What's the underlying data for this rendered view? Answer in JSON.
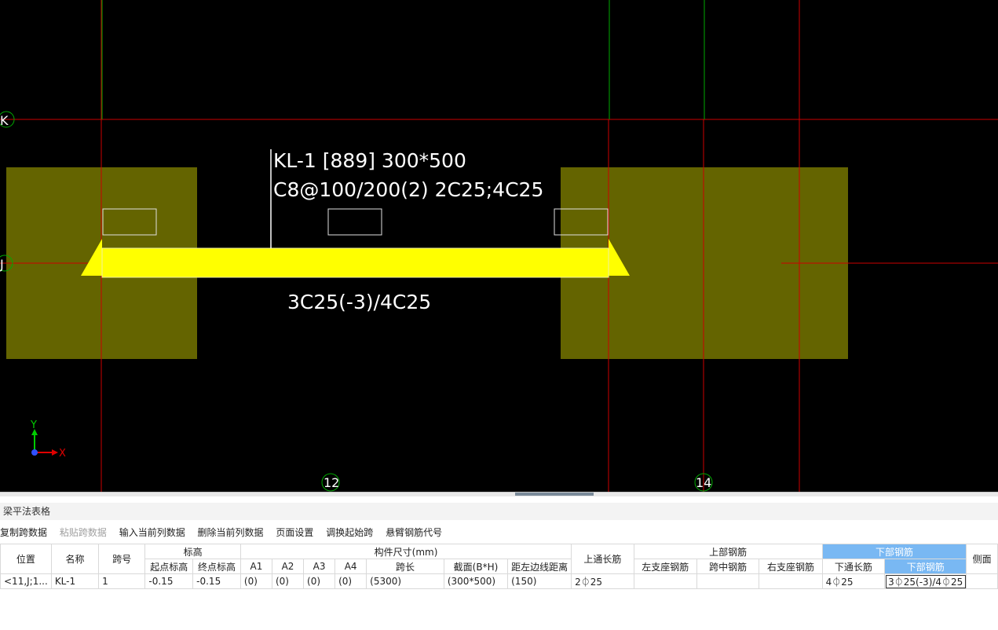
{
  "cad": {
    "axes": {
      "k": "K",
      "j": "J",
      "n12": "12",
      "n14": "14"
    },
    "beam_label_line1": "KL-1 [889] 300*500",
    "beam_label_line2": "C8@100/200(2) 2C25;4C25",
    "beam_bottom_label": "3C25(-3)/4C25",
    "ucs_x": "X",
    "ucs_y": "Y",
    "colors": {
      "background": "#000000",
      "beam": "#ffff00",
      "column": "#646400",
      "grid_red": "#cc0000",
      "grid_green": "#00aa00"
    }
  },
  "panel": {
    "title": "梁平法表格",
    "toolbar": [
      {
        "label": "复制跨数据",
        "enabled": true
      },
      {
        "label": "粘贴跨数据",
        "enabled": false
      },
      {
        "label": "输入当前列数据",
        "enabled": true
      },
      {
        "label": "删除当前列数据",
        "enabled": true
      },
      {
        "label": "页面设置",
        "enabled": true
      },
      {
        "label": "调换起始跨",
        "enabled": true
      },
      {
        "label": "悬臂钢筋代号",
        "enabled": true
      }
    ],
    "table": {
      "group_headers": {
        "position": "位置",
        "name": "名称",
        "span": "跨号",
        "elevation": "标高",
        "dimension": "构件尺寸(mm)",
        "top_through": "上通长筋",
        "top_rebar": "上部钢筋",
        "bottom_rebar": "下部钢筋",
        "side": "侧面"
      },
      "sub_headers": {
        "start_elev": "起点标高",
        "end_elev": "终点标高",
        "a1": "A1",
        "a2": "A2",
        "a3": "A3",
        "a4": "A4",
        "span_len": "跨长",
        "section": "截面(B*H)",
        "dist_left": "距左边线距离",
        "left_support": "左支座钢筋",
        "mid_span": "跨中钢筋",
        "right_support": "右支座钢筋",
        "bottom_through": "下通长筋",
        "bottom_rebar2": "下部钢筋"
      },
      "row": {
        "position": "<11,J;1...",
        "name": "KL-1",
        "span": "1",
        "start_elev": "-0.15",
        "end_elev": "-0.15",
        "a1": "(0)",
        "a2": "(0)",
        "a3": "(0)",
        "a4": "(0)",
        "span_len": "(5300)",
        "section": "(300*500)",
        "dist_left": "(150)",
        "top_through": "2⏀25",
        "left_support": "",
        "mid_span": "",
        "right_support": "",
        "bottom_through": "4⏀25",
        "bottom_rebar": "3⏀25(-3)/4⏀25",
        "side": ""
      }
    }
  }
}
